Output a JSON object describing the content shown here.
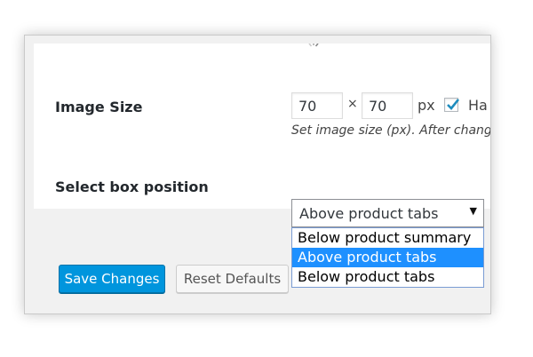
{
  "settings": {
    "image_size": {
      "label": "Image Size",
      "width_value": "70",
      "height_value": "70",
      "separator": "×",
      "unit": "px",
      "checkbox_checked": true,
      "checkbox_label": "Ha",
      "help_text": "Set image size (px). After changing"
    },
    "box_position": {
      "label": "Select box position",
      "selected": "Above product tabs",
      "options": [
        "Below product summary",
        "Above product tabs",
        "Below product tabs"
      ],
      "highlighted_index": 1
    }
  },
  "buttons": {
    "save": "Save Changes",
    "reset": "Reset Defaults"
  },
  "colors": {
    "primary": "#0095dd",
    "highlight": "#1e90ff"
  },
  "icons": {
    "spinner": "loading-spinner-icon",
    "checkmark": "checkmark-icon",
    "dropdown_arrow": "caret-down-icon"
  }
}
